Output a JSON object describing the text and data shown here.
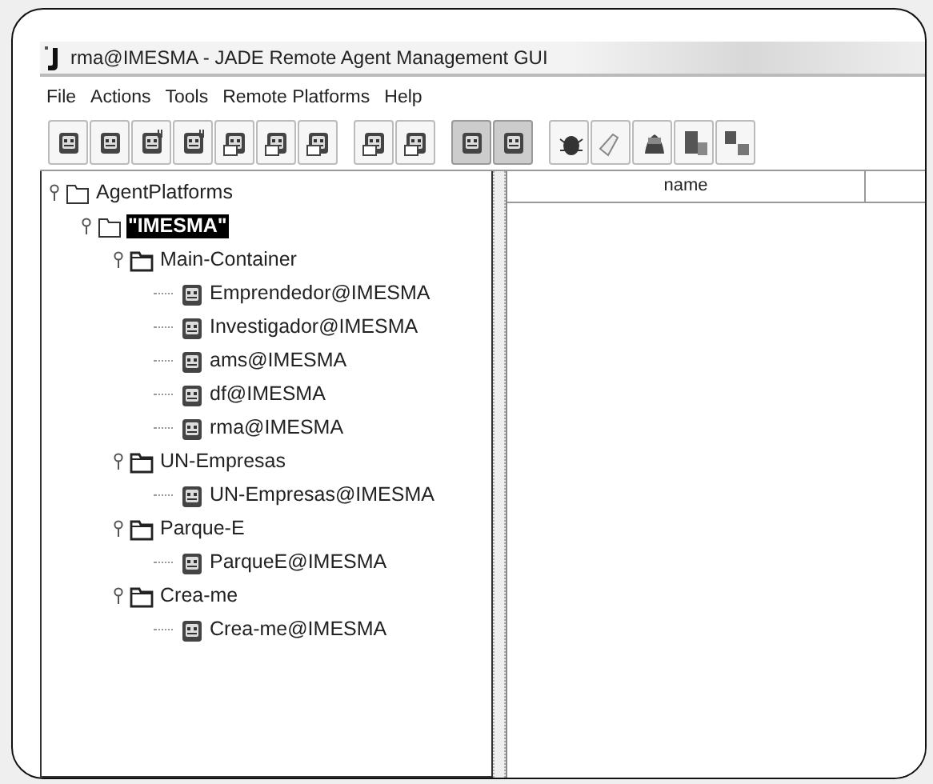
{
  "window": {
    "title": "rma@IMESMA - JADE Remote Agent Management GUI"
  },
  "menu": [
    "File",
    "Actions",
    "Tools",
    "Remote Platforms",
    "Help"
  ],
  "tree": [
    {
      "kind": "root",
      "label": "AgentPlatforms",
      "expanded": true,
      "selected": false,
      "children": [
        {
          "kind": "platform",
          "label": "\"IMESMA\"",
          "expanded": true,
          "selected": true,
          "children": [
            {
              "kind": "container",
              "label": "Main-Container",
              "expanded": true,
              "selected": false,
              "children": [
                {
                  "kind": "agent",
                  "label": "Emprendedor@IMESMA",
                  "selected": false
                },
                {
                  "kind": "agent",
                  "label": "Investigador@IMESMA",
                  "selected": false
                },
                {
                  "kind": "agent",
                  "label": "ams@IMESMA",
                  "selected": false
                },
                {
                  "kind": "agent",
                  "label": "df@IMESMA",
                  "selected": false
                },
                {
                  "kind": "agent",
                  "label": "rma@IMESMA",
                  "selected": false
                }
              ]
            },
            {
              "kind": "container",
              "label": "UN-Empresas",
              "expanded": true,
              "selected": false,
              "children": [
                {
                  "kind": "agent",
                  "label": "UN-Empresas@IMESMA",
                  "selected": false
                }
              ]
            },
            {
              "kind": "container",
              "label": "Parque-E",
              "expanded": true,
              "selected": false,
              "children": [
                {
                  "kind": "agent",
                  "label": "ParqueE@IMESMA",
                  "selected": false
                }
              ]
            },
            {
              "kind": "container",
              "label": "Crea-me",
              "expanded": true,
              "selected": false,
              "children": [
                {
                  "kind": "agent",
                  "label": "Crea-me@IMESMA",
                  "selected": false
                }
              ]
            }
          ]
        }
      ]
    }
  ],
  "table": {
    "columns": [
      "name"
    ]
  }
}
